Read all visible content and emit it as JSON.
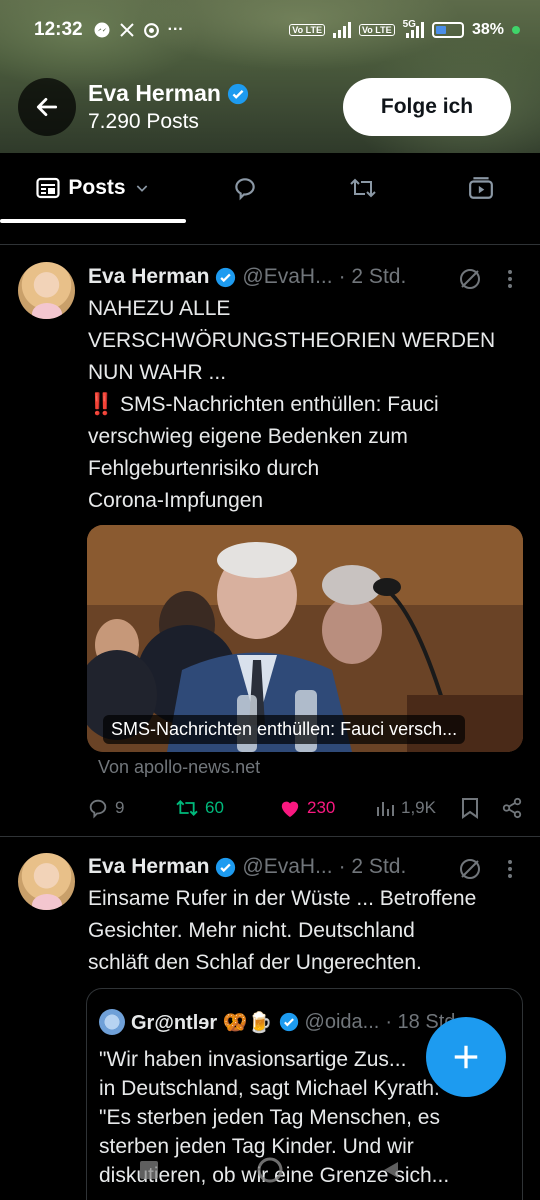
{
  "status_bar": {
    "time": "12:32",
    "left_icons": [
      "messenger-icon",
      "x-icon",
      "chrome-icon"
    ],
    "more": "···",
    "volte1": "Vo LTE",
    "volte2": "Vo LTE",
    "network": "5G",
    "battery": "38%"
  },
  "header": {
    "name": "Eva Herman",
    "post_count": "7.290 Posts",
    "follow_label": "Folge ich"
  },
  "tabs": {
    "posts_label": "Posts",
    "icons": [
      "reply-icon",
      "repost-icon",
      "media-icon"
    ]
  },
  "tweet1": {
    "name": "Eva Herman",
    "handle": "@EvaH...",
    "time": "· 2 Std.",
    "text_line1": "NAHEZU ALLE\nVERSCHWÖRUNGSTHEORIEN WERDEN\nNUN WAHR ...",
    "text_line2": "‼️ SMS-Nachrichten enthüllen: Fauci\nverschwieg eigene Bedenken zum\nFehlgeburtenrisiko durch\nCorona-Impfungen",
    "card_caption": "SMS-Nachrichten enthüllen: Fauci versch...",
    "card_source": "Von apollo-news.net",
    "replies": "9",
    "reposts": "60",
    "likes": "230",
    "views": "1,9K"
  },
  "tweet2": {
    "name": "Eva Herman",
    "handle": "@EvaH...",
    "time": "· 2 Std.",
    "text": "Einsame Rufer in der Wüste ... Betroffene\nGesichter. Mehr nicht. Deutschland\nschläft den Schlaf der Ungerechten.",
    "quote": {
      "name": "Gr@ntlɘr 🥨🍺",
      "handle": "@oida...",
      "time": "· 18 Std.",
      "text": "\"Wir haben invasionsartige Zus...\nin Deutschland, sagt Michael Kyrath.\n\"Es sterben jeden Tag Menschen, es\nsterben jeden Tag Kinder. Und wir\ndiskutieren, ob wir  eine Grenze sich..."
    }
  },
  "colors": {
    "accent": "#1d9bf0",
    "repost": "#00ba7c",
    "like": "#f91880",
    "muted": "#71767b"
  }
}
